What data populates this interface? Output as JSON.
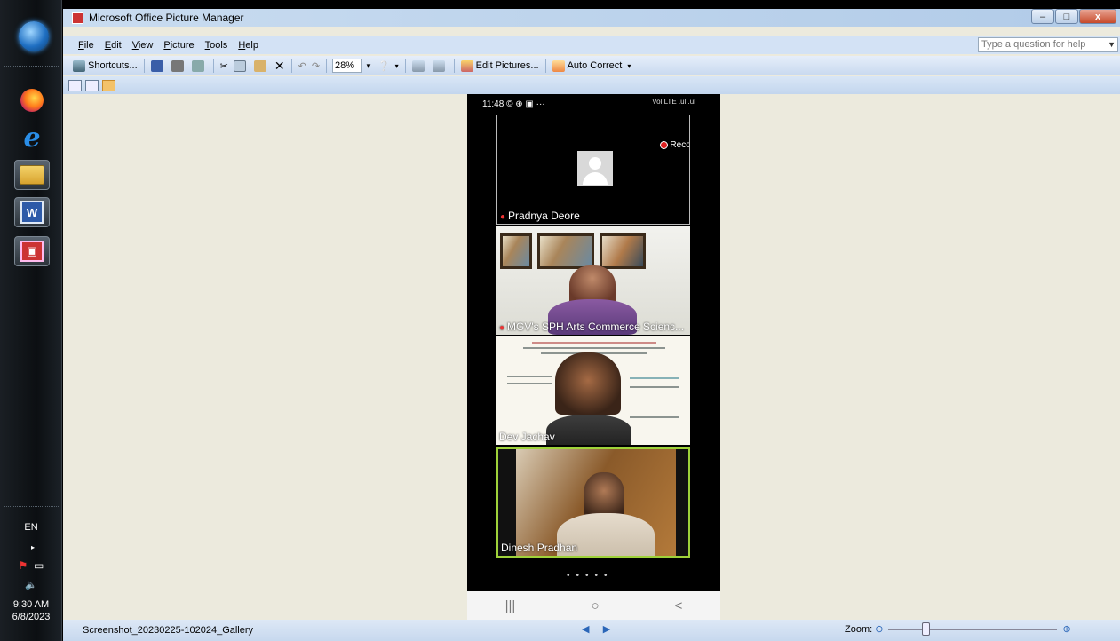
{
  "taskbar": {
    "language": "EN",
    "time": "9:30 AM",
    "date": "6/8/2023"
  },
  "window": {
    "title": "Microsoft Office Picture Manager",
    "buttons": [
      "–",
      "□",
      "x"
    ]
  },
  "menu": {
    "items": [
      {
        "u": "F",
        "rest": "ile"
      },
      {
        "u": "E",
        "rest": "dit"
      },
      {
        "u": "V",
        "rest": "iew"
      },
      {
        "u": "P",
        "rest": "icture"
      },
      {
        "u": "T",
        "rest": "ools"
      },
      {
        "u": "H",
        "rest": "elp"
      }
    ],
    "help_placeholder": "Type a question for help"
  },
  "toolbar": {
    "shortcuts_label": "Shortcuts...",
    "zoom_value": "28%",
    "edit_pictures_label": "Edit Pictures...",
    "auto_correct_label": "Auto Correct"
  },
  "phone": {
    "status_time": "11:48",
    "status_icons": "© ⊕ ▣ ···",
    "signal": "Vol LTE .ul .ul",
    "recording_label": "Recording",
    "participants": [
      {
        "name": "Pradnya Deore",
        "muted": true
      },
      {
        "name": "MGV's SPH Arts Commerce Scienc...",
        "muted": true
      },
      {
        "name": "Dev Jachav",
        "muted": false
      },
      {
        "name": "Dinesh Pradhan",
        "muted": false
      }
    ],
    "page_dots": "•••••",
    "nav": [
      "|||",
      "○",
      "<"
    ]
  },
  "statusbar": {
    "filename": "Screenshot_20230225-102024_Gallery",
    "zoom_label": "Zoom:"
  },
  "colors": {
    "canvas_bg": "#eceadd",
    "active_speaker_border": "#9fd23a"
  }
}
